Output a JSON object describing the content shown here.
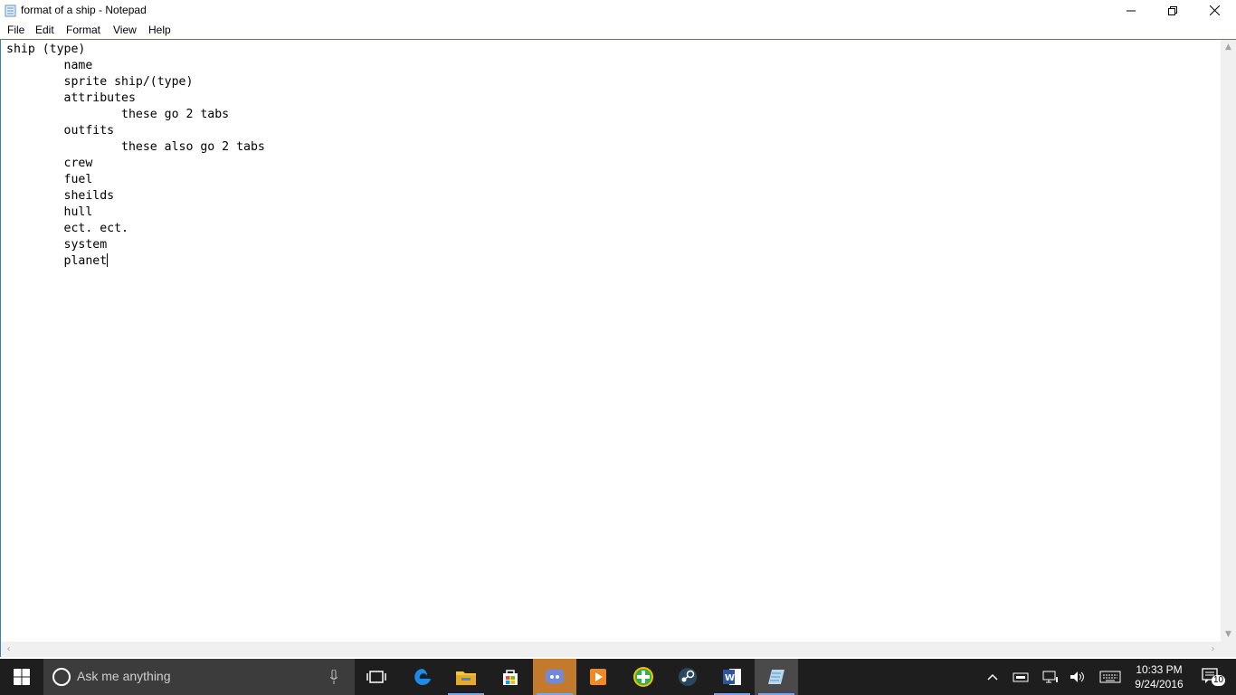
{
  "window": {
    "title": "format of a ship - Notepad",
    "accent_color": "#3c7fb1"
  },
  "menu": {
    "items": [
      "File",
      "Edit",
      "Format",
      "View",
      "Help"
    ]
  },
  "document": {
    "lines": [
      "ship (type)",
      "        name",
      "        sprite ship/(type)",
      "        attributes",
      "                these go 2 tabs",
      "        outfits",
      "                these also go 2 tabs",
      "        crew",
      "        fuel",
      "        sheilds",
      "        hull",
      "        ect. ect.",
      "        system",
      "        planet"
    ]
  },
  "taskbar": {
    "search_placeholder": "Ask me anything",
    "apps": [
      "task-view-icon",
      "edge-icon",
      "file-explorer-icon",
      "store-icon",
      "discord-icon",
      "media-player-icon",
      "green-plus-app-icon",
      "steam-icon",
      "word-icon",
      "notepad-icon"
    ],
    "clock_time": "10:33 PM",
    "clock_date": "9/24/2016",
    "notification_count": "10"
  }
}
